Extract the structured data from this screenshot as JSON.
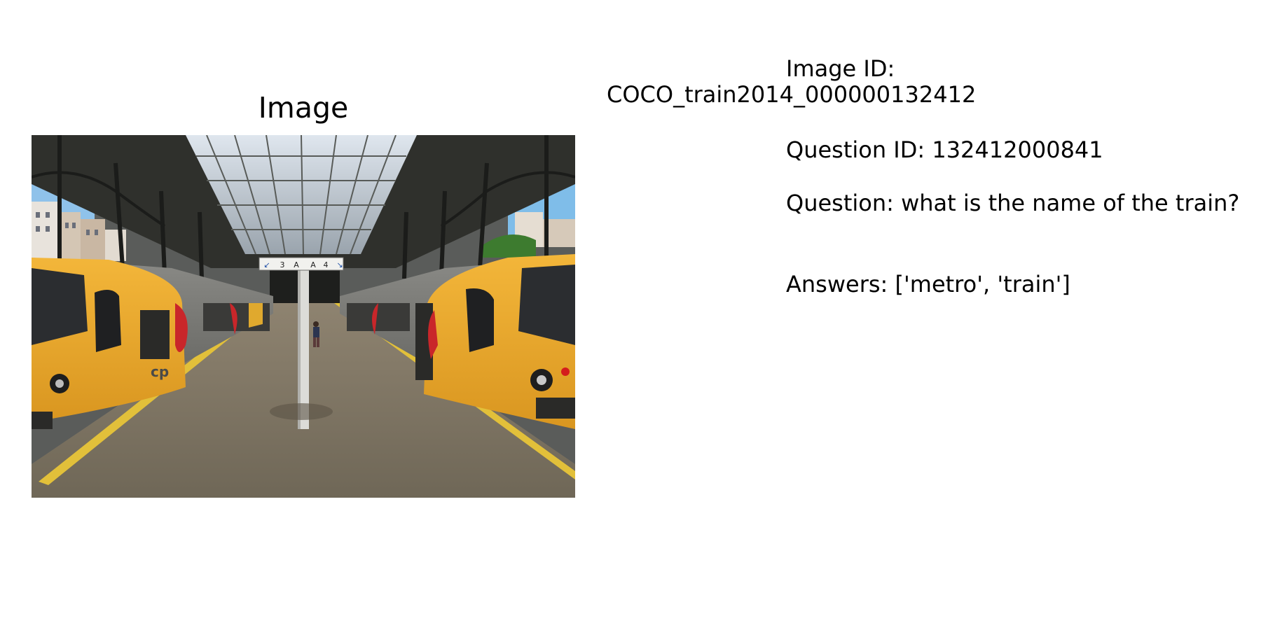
{
  "image_panel": {
    "title": "Image",
    "sign_labels": {
      "left_track": "3",
      "letter_a": "A",
      "letter_a2": "A",
      "right_track": "4"
    },
    "train_logo": "cp"
  },
  "info_panel": {
    "image_id_label": "Image ID:",
    "image_id_value": "COCO_train2014_000000132412",
    "question_id": "Question ID: 132412000841",
    "question": "Question: what is the name of the train?",
    "answers": "Answers: ['metro', 'train']"
  }
}
